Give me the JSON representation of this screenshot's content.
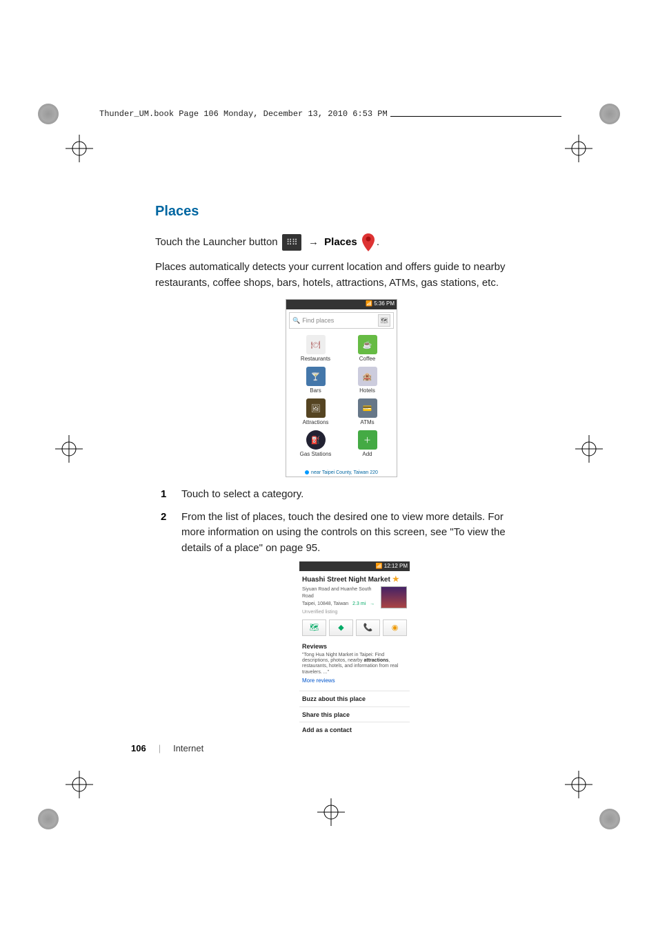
{
  "header": {
    "running_text": "Thunder_UM.book  Page 106   Monday, December 13, 2010   6:53 PM"
  },
  "section": {
    "title": "Places",
    "intro_prefix": "Touch the Launcher button ",
    "intro_arrow": "→",
    "intro_places_label": "Places",
    "intro_suffix": ".",
    "body": "Places automatically detects your current location and offers guide to nearby restaurants, coffee shops, bars, hotels, attractions, ATMs, gas stations, etc."
  },
  "shot1": {
    "status_time": "5:36 PM",
    "search_placeholder": "Find places",
    "categories": [
      {
        "label": "Restaurants",
        "icon": "🍽"
      },
      {
        "label": "Coffee",
        "icon": "☕"
      },
      {
        "label": "Bars",
        "icon": "🍸"
      },
      {
        "label": "Hotels",
        "icon": "🏨"
      },
      {
        "label": "Attractions",
        "icon": "🖼"
      },
      {
        "label": "ATMs",
        "icon": "💳"
      },
      {
        "label": "Gas Stations",
        "icon": "⛽"
      },
      {
        "label": "Add",
        "icon": "＋"
      }
    ],
    "location_line": "near Taipei County, Taiwan 220"
  },
  "steps": {
    "s1": "Touch to select a category.",
    "s2": "From the list of places, touch the desired one to view more details. For more information on using the controls on this screen, see \"To view the details of a place\" on page 95."
  },
  "shot2": {
    "status_time": "12:12 PM",
    "title": "Huashi Street Night Market",
    "addr1": "Siyuan Road and Huanhe South Road",
    "addr2": "Taipei, 10848, Taiwan",
    "distance": "2.3 mi",
    "unverified": "Unverified listing",
    "reviews_label": "Reviews",
    "review_body_a": "\"Tong Hua Night Market in Taipei: Find descriptions, photos, nearby ",
    "review_body_bold": "attractions",
    "review_body_b": ", restaurants, hotels, and information from real travelers. ...\"",
    "more_reviews": "More reviews",
    "buzz": "Buzz about this place",
    "share": "Share this place",
    "add_contact": "Add as a contact"
  },
  "footer": {
    "page_number": "106",
    "chapter": "Internet"
  }
}
